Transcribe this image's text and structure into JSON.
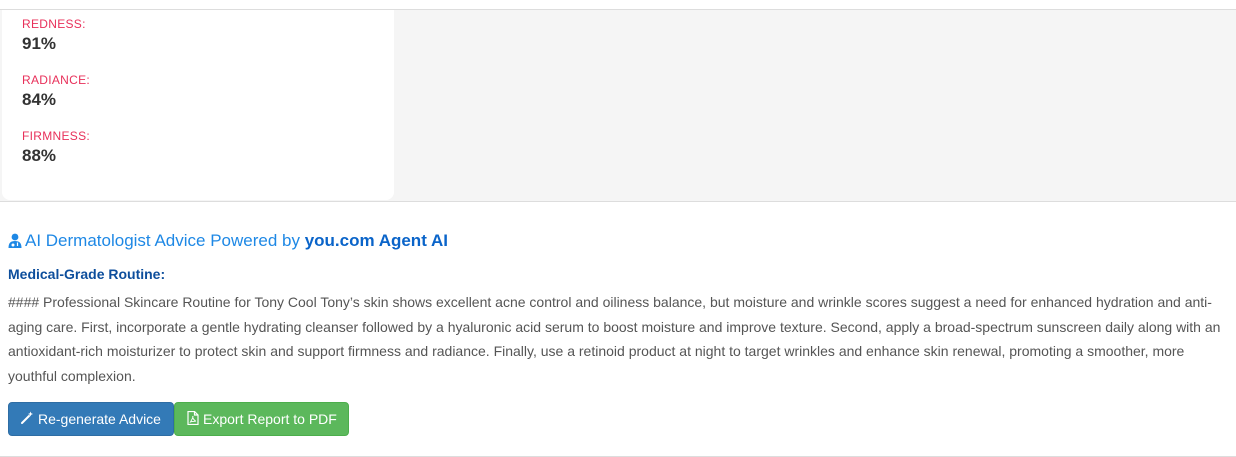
{
  "metrics": [
    {
      "label": "REDNESS:",
      "value": "91%"
    },
    {
      "label": "RADIANCE:",
      "value": "84%"
    },
    {
      "label": "FIRMNESS:",
      "value": "88%"
    }
  ],
  "advice": {
    "icon": "user-doctor-icon",
    "title_prefix": "AI Dermatologist Advice Powered by",
    "brand": "you.com Agent AI",
    "routine_heading": "Medical-Grade Routine:",
    "body": "#### Professional Skincare Routine for Tony Cool Tony’s skin shows excellent acne control and oiliness balance, but moisture and wrinkle scores suggest a need for enhanced hydration and anti-aging care. First, incorporate a gentle hydrating cleanser followed by a hyaluronic acid serum to boost moisture and improve texture. Second, apply a broad-spectrum sunscreen daily along with an antioxidant-rich moisturizer to protect skin and support firmness and radiance. Finally, use a retinoid product at night to target wrinkles and enhance skin renewal, promoting a smoother, more youthful complexion."
  },
  "buttons": {
    "regenerate_label": "Re-generate Advice",
    "regenerate_icon": "magic-wand-icon",
    "export_label": "Export Report to PDF",
    "export_icon": "pdf-file-icon"
  },
  "colors": {
    "metric_label": "#e8305a",
    "title_blue": "#1e88e5",
    "heading_blue": "#0d4e9c",
    "primary_button": "#337ab7",
    "success_button": "#5cb85c"
  }
}
